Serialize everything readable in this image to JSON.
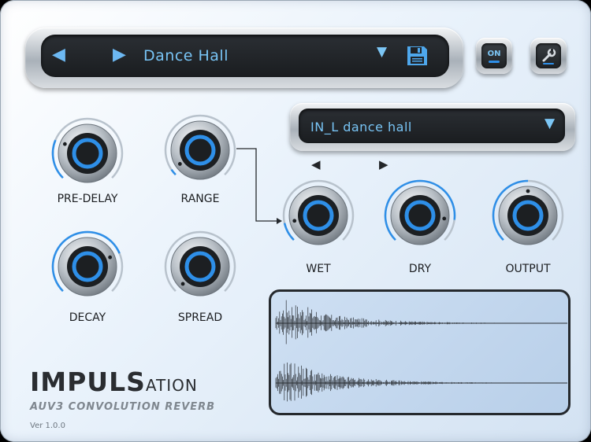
{
  "preset": {
    "name": "Dance Hall",
    "prev_icon": "triangle-left-icon",
    "next_icon": "triangle-right-icon",
    "dropdown_icon": "triangle-down-icon",
    "save_icon": "floppy-disk-icon"
  },
  "power_button": {
    "label": "ON"
  },
  "settings_button": {
    "icon": "wrench-icon"
  },
  "impulse": {
    "selected": "IN_L dance hall"
  },
  "knobs": [
    {
      "label": "PRE-DELAY",
      "level": 0.25
    },
    {
      "label": "RANGE",
      "level": 0.04
    },
    {
      "label": "DECAY",
      "level": 0.75
    },
    {
      "label": "SPREAD",
      "level": 0.0
    },
    {
      "label": "WET",
      "level": 0.12
    },
    {
      "label": "DRY",
      "level": 0.86
    },
    {
      "label": "OUTPUT",
      "level": 0.5
    }
  ],
  "brand": {
    "name_bold": "IMPULS",
    "name_small": "ATION",
    "subtitle": "AUV3 CONVOLUTION REVERB",
    "version": "Ver 1.0.0"
  },
  "colors": {
    "accent": "#2e8fe8",
    "screen": "#1f2226",
    "text_blue": "#78c4f5"
  }
}
